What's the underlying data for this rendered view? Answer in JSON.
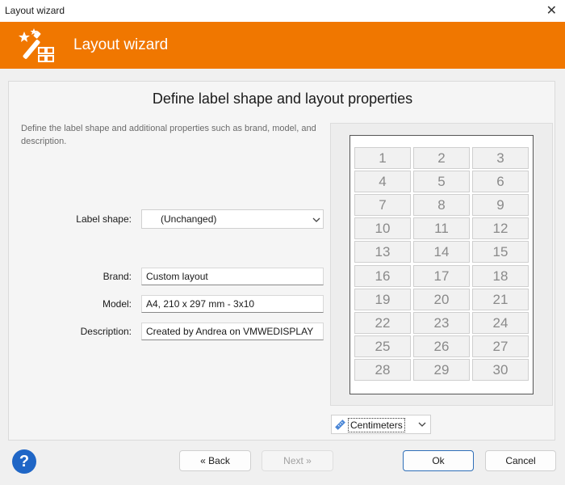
{
  "window": {
    "title": "Layout wizard",
    "close_icon": "close-icon"
  },
  "header": {
    "title": "Layout wizard",
    "icon": "magic-wand-icon",
    "color": "#f07700"
  },
  "main": {
    "heading": "Define label shape and layout properties",
    "description": "Define the label shape and additional properties such as brand, model, and description."
  },
  "form": {
    "label_shape": {
      "label": "Label shape:",
      "value": "(Unchanged)"
    },
    "brand": {
      "label": "Brand:",
      "value": "Custom layout"
    },
    "model": {
      "label": "Model:",
      "value": "A4, 210 x 297 mm - 3x10"
    },
    "description": {
      "label": "Description:",
      "value": "Created by Andrea on VMWEDISPLAY"
    }
  },
  "preview": {
    "columns": 3,
    "rows": 10,
    "labels": [
      "1",
      "2",
      "3",
      "4",
      "5",
      "6",
      "7",
      "8",
      "9",
      "10",
      "11",
      "12",
      "13",
      "14",
      "15",
      "16",
      "17",
      "18",
      "19",
      "20",
      "21",
      "22",
      "23",
      "24",
      "25",
      "26",
      "27",
      "28",
      "29",
      "30"
    ]
  },
  "units": {
    "value": "Centimeters",
    "icon": "ruler-icon"
  },
  "buttons": {
    "back": "« Back",
    "next": "Next »",
    "ok": "Ok",
    "cancel": "Cancel",
    "help_icon": "help-icon"
  }
}
